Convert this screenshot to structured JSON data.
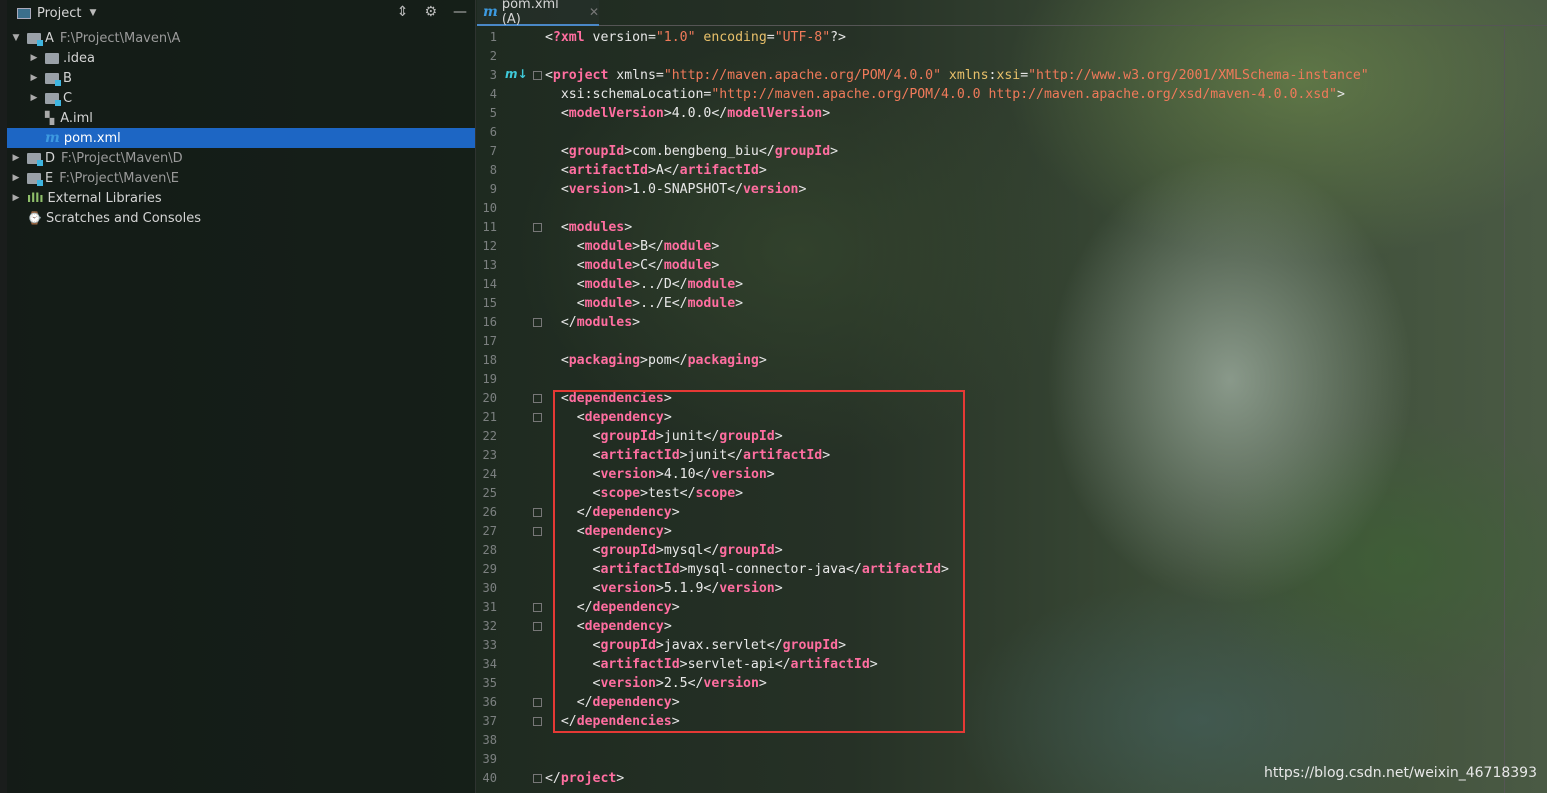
{
  "sidebar": {
    "title": "Project",
    "tree": [
      {
        "name": "A",
        "path": "F:\\Project\\Maven\\A",
        "icon": "module-folder-icon",
        "expanded": true,
        "level": 0
      },
      {
        "name": ".idea",
        "icon": "folder-icon",
        "level": 1
      },
      {
        "name": "B",
        "icon": "module-folder-icon",
        "level": 1
      },
      {
        "name": "C",
        "icon": "module-folder-icon",
        "level": 1
      },
      {
        "name": "A.iml",
        "icon": "iml-file-icon",
        "level": 1
      },
      {
        "name": "pom.xml",
        "icon": "maven-icon",
        "level": 1,
        "selected": true
      },
      {
        "name": "D",
        "path": "F:\\Project\\Maven\\D",
        "icon": "module-folder-icon",
        "level": 0
      },
      {
        "name": "E",
        "path": "F:\\Project\\Maven\\E",
        "icon": "module-folder-icon",
        "level": 0
      },
      {
        "name": "External Libraries",
        "icon": "libraries-icon",
        "level": 0
      },
      {
        "name": "Scratches and Consoles",
        "icon": "scratches-icon",
        "level": 0
      }
    ]
  },
  "editor": {
    "tab": "pom.xml (A)",
    "lines": [
      "<?xml version=\"1.0\" encoding=\"UTF-8\"?>",
      "",
      "<project xmlns=\"http://maven.apache.org/POM/4.0.0\" xmlns:xsi=\"http://www.w3.org/2001/XMLSchema-instance\"",
      "  xsi:schemaLocation=\"http://maven.apache.org/POM/4.0.0 http://maven.apache.org/xsd/maven-4.0.0.xsd\">",
      "  <modelVersion>4.0.0</modelVersion>",
      "",
      "  <groupId>com.bengbeng_biu</groupId>",
      "  <artifactId>A</artifactId>",
      "  <version>1.0-SNAPSHOT</version>",
      "",
      "  <modules>",
      "    <module>B</module>",
      "    <module>C</module>",
      "    <module>../D</module>",
      "    <module>../E</module>",
      "  </modules>",
      "",
      "  <packaging>pom</packaging>",
      "",
      "  <dependencies>",
      "    <dependency>",
      "      <groupId>junit</groupId>",
      "      <artifactId>junit</artifactId>",
      "      <version>4.10</version>",
      "      <scope>test</scope>",
      "    </dependency>",
      "    <dependency>",
      "      <groupId>mysql</groupId>",
      "      <artifactId>mysql-connector-java</artifactId>",
      "      <version>5.1.9</version>",
      "    </dependency>",
      "    <dependency>",
      "      <groupId>javax.servlet</groupId>",
      "      <artifactId>servlet-api</artifactId>",
      "      <version>2.5</version>",
      "    </dependency>",
      "  </dependencies>",
      "",
      "",
      "</project>"
    ]
  },
  "watermark": "https://blog.csdn.net/weixin_46718393",
  "colors": {
    "tag": "#ff6ea0",
    "attr": "#e8c06a",
    "value": "#f07a5a",
    "selection": "#1d66c4",
    "highlight_box": "#e53935"
  }
}
